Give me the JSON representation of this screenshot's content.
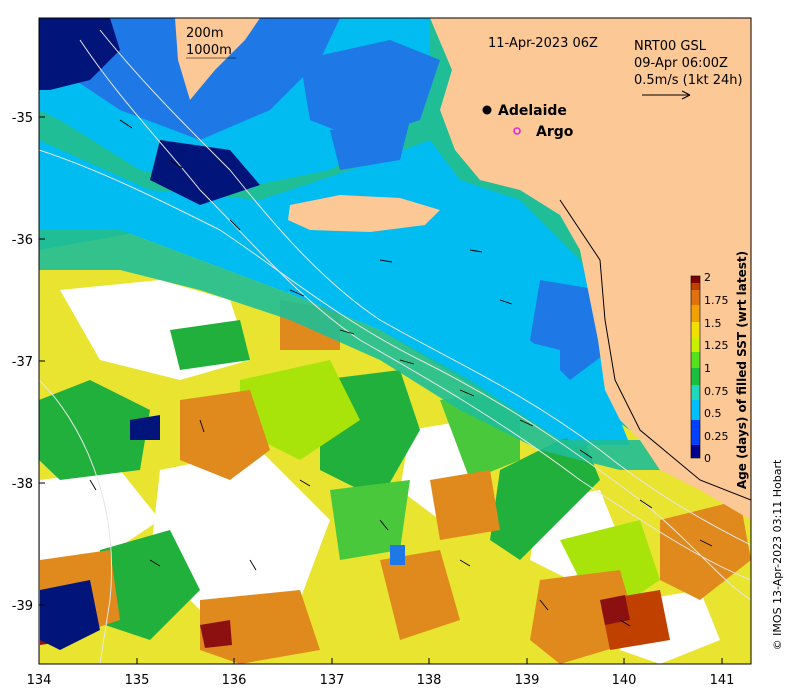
{
  "map": {
    "timestamp": "11-Apr-2023 06Z",
    "depth_contours": [
      "200m",
      "1000m"
    ],
    "current_source": "NRT00 GSL",
    "current_time": "09-Apr 06:00Z",
    "current_scale": "0.5m/s (1kt 24h)",
    "places": [
      {
        "name": "Adelaide",
        "marker": "filled-circle"
      },
      {
        "name": "Argo",
        "marker": "open-circle"
      }
    ],
    "x_axis": {
      "ticks": [
        "134",
        "135",
        "136",
        "137",
        "138",
        "139",
        "140",
        "141"
      ],
      "range": [
        134,
        141.3
      ]
    },
    "y_axis": {
      "ticks": [
        "-35",
        "-36",
        "-37",
        "-38",
        "-39"
      ],
      "range": [
        -39.5,
        -34.2
      ]
    },
    "colorbar": {
      "label": "Age (days) of filled SST (wrt latest)",
      "ticks": [
        "2",
        "1.75",
        "1.5",
        "1.25",
        "1",
        "0.75",
        "0.5",
        "0.25",
        "0"
      ],
      "colors": [
        "#00008f",
        "#0040ff",
        "#00bfff",
        "#1ed8c0",
        "#19c040",
        "#55e020",
        "#c8f000",
        "#f0e000",
        "#f0a000",
        "#e07010",
        "#c04000",
        "#800000"
      ]
    },
    "credit": "© IMOS 13-Apr-2023 03:11 Hobart",
    "colors": {
      "land": "#fcc896",
      "navy": "#00147a",
      "blue": "#1e78e6",
      "cyan": "#00bcf0",
      "teal": "#1fbe96",
      "green": "#22b03c",
      "lime": "#a8e40a",
      "yellow": "#e8e430",
      "orange": "#e08a1e",
      "darkred": "#8c1010"
    }
  }
}
